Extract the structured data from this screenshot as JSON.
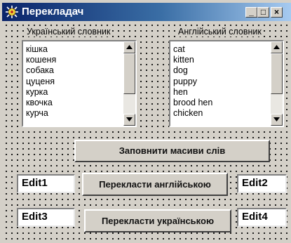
{
  "window": {
    "title": "Перекладач",
    "buttons": {
      "minimize": "_",
      "maximize": "□",
      "close": "×"
    }
  },
  "ukrainian_dictionary": {
    "label": "Український словник",
    "items": [
      "кішка",
      "кошеня",
      "собака",
      "цуценя",
      "курка",
      "квочка",
      "курча"
    ]
  },
  "english_dictionary": {
    "label": "Англійський словник",
    "items": [
      "cat",
      "kitten",
      "dog",
      "puppy",
      "hen",
      "brood hen",
      "chicken"
    ]
  },
  "buttons": {
    "fill": "Заповнити масиви слів",
    "to_english": "Перекласти англійською",
    "to_ukrainian": "Перекласти українською"
  },
  "edits": {
    "edit1": "Edit1",
    "edit2": "Edit2",
    "edit3": "Edit3",
    "edit4": "Edit4"
  },
  "icons": {
    "app": "app-icon",
    "scroll_up": "arrow-up-icon",
    "scroll_down": "arrow-down-icon"
  },
  "colors": {
    "title_gradient_start": "#0a246a",
    "title_gradient_end": "#a6caf0",
    "face": "#d4d0c8"
  }
}
